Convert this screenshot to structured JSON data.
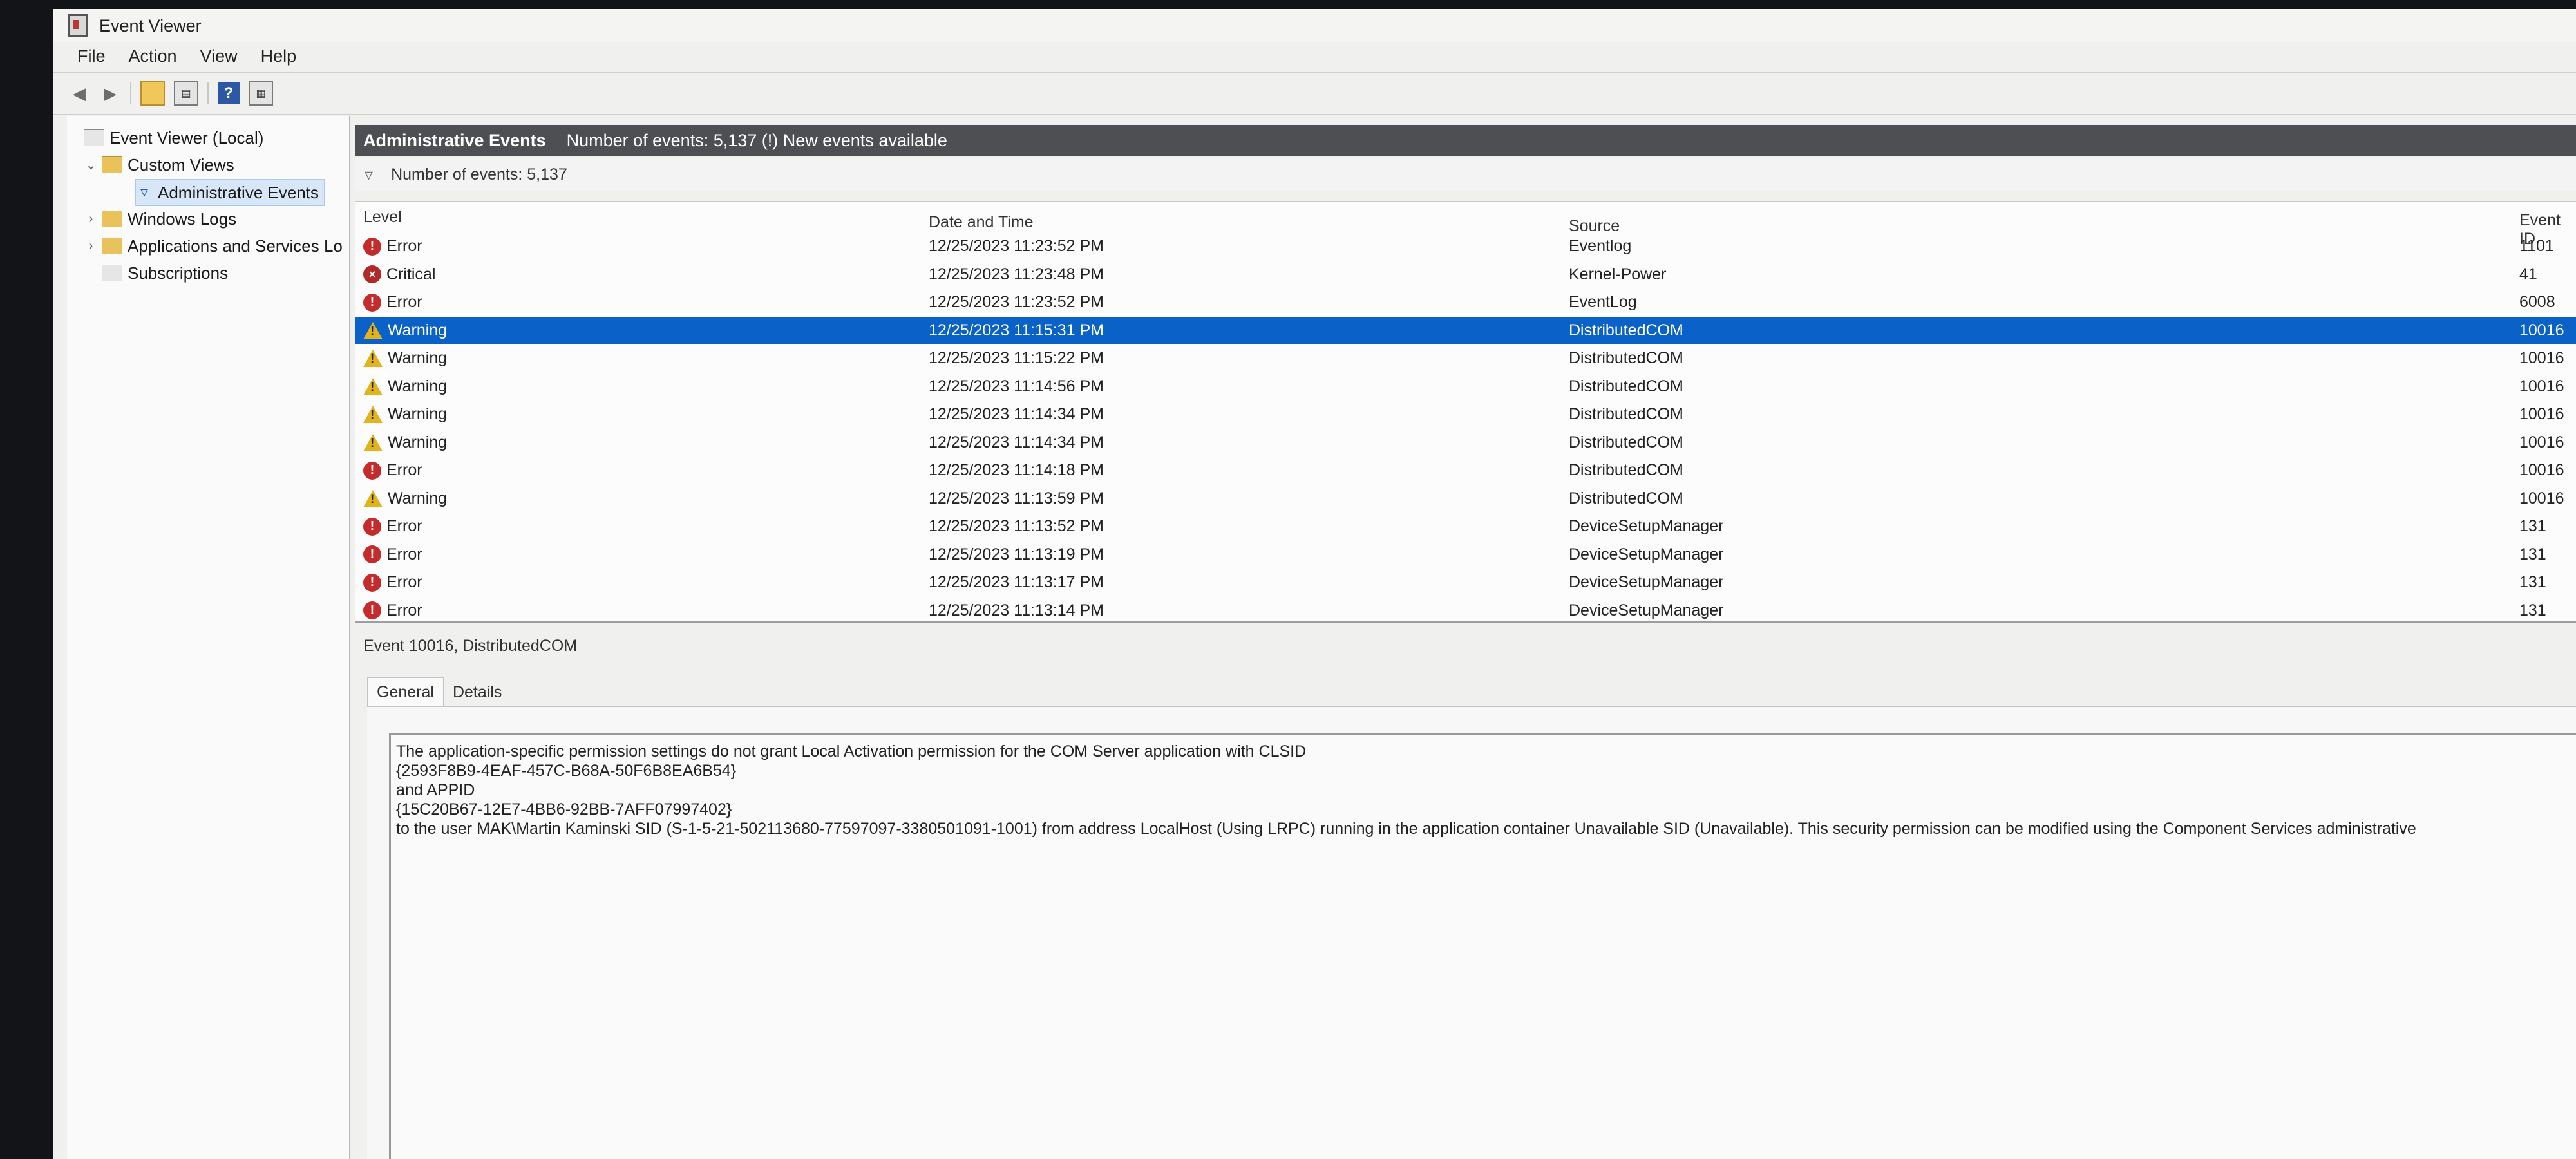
{
  "window": {
    "title": "Event Viewer"
  },
  "menu": [
    "File",
    "Action",
    "View",
    "Help"
  ],
  "toolbar": {
    "icons": [
      "back-arrow-icon",
      "forward-arrow-icon",
      "folder-up-icon",
      "show-hide-tree-icon",
      "help-icon",
      "action-pane-icon"
    ]
  },
  "tree": {
    "root": "Event Viewer (Local)",
    "custom_views": "Custom Views",
    "administrative_events": "Administrative Events",
    "windows_logs": "Windows Logs",
    "apps_services": "Applications and Services Lo",
    "subscriptions": "Subscriptions"
  },
  "header": {
    "title": "Administrative Events",
    "count_text": "Number of events: 5,137 (!) New events available"
  },
  "filter": {
    "text": "Number of events: 5,137"
  },
  "columns": {
    "level": "Level",
    "datetime": "Date and Time",
    "source": "Source",
    "event_id": "Event ID"
  },
  "events": [
    {
      "level": "Error",
      "icon": "error-icon",
      "datetime": "12/25/2023 11:23:52 PM",
      "source": "Eventlog",
      "event_id": "1101"
    },
    {
      "level": "Critical",
      "icon": "critical-icon",
      "datetime": "12/25/2023 11:23:48 PM",
      "source": "Kernel-Power",
      "event_id": "41"
    },
    {
      "level": "Error",
      "icon": "error-icon",
      "datetime": "12/25/2023 11:23:52 PM",
      "source": "EventLog",
      "event_id": "6008"
    },
    {
      "level": "Warning",
      "icon": "warning-icon",
      "datetime": "12/25/2023 11:15:31 PM",
      "source": "DistributedCOM",
      "event_id": "10016",
      "selected": true
    },
    {
      "level": "Warning",
      "icon": "warning-icon",
      "datetime": "12/25/2023 11:15:22 PM",
      "source": "DistributedCOM",
      "event_id": "10016"
    },
    {
      "level": "Warning",
      "icon": "warning-icon",
      "datetime": "12/25/2023 11:14:56 PM",
      "source": "DistributedCOM",
      "event_id": "10016"
    },
    {
      "level": "Warning",
      "icon": "warning-icon",
      "datetime": "12/25/2023 11:14:34 PM",
      "source": "DistributedCOM",
      "event_id": "10016"
    },
    {
      "level": "Warning",
      "icon": "warning-icon",
      "datetime": "12/25/2023 11:14:34 PM",
      "source": "DistributedCOM",
      "event_id": "10016"
    },
    {
      "level": "Error",
      "icon": "error-icon",
      "datetime": "12/25/2023 11:14:18 PM",
      "source": "DistributedCOM",
      "event_id": "10016"
    },
    {
      "level": "Warning",
      "icon": "warning-icon",
      "datetime": "12/25/2023 11:13:59 PM",
      "source": "DistributedCOM",
      "event_id": "10016"
    },
    {
      "level": "Error",
      "icon": "error-icon",
      "datetime": "12/25/2023 11:13:52 PM",
      "source": "DeviceSetupManager",
      "event_id": "131"
    },
    {
      "level": "Error",
      "icon": "error-icon",
      "datetime": "12/25/2023 11:13:19 PM",
      "source": "DeviceSetupManager",
      "event_id": "131"
    },
    {
      "level": "Error",
      "icon": "error-icon",
      "datetime": "12/25/2023 11:13:17 PM",
      "source": "DeviceSetupManager",
      "event_id": "131"
    },
    {
      "level": "Error",
      "icon": "error-icon",
      "datetime": "12/25/2023 11:13:14 PM",
      "source": "DeviceSetupManager",
      "event_id": "131"
    }
  ],
  "detail": {
    "header": "Event 10016, DistributedCOM",
    "tabs": [
      "General",
      "Details"
    ],
    "lines": [
      "The application-specific permission settings do not grant Local Activation permission for the COM Server application with CLSID",
      "{2593F8B9-4EAF-457C-B68A-50F6B8EA6B54}",
      " and APPID",
      "{15C20B67-12E7-4BB6-92BB-7AFF07997402}",
      " to the user MAK\\Martin Kaminski SID (S-1-5-21-502113680-77597097-3380501091-1001) from address LocalHost (Using LRPC) running in the application container Unavailable SID (Unavailable). This security permission can be modified using the Component Services administrative"
    ]
  },
  "colors": {
    "selection": "#0a62c8",
    "header_bar": "#4e4f52",
    "error": "#c62b2b",
    "warning": "#e3b31b"
  }
}
